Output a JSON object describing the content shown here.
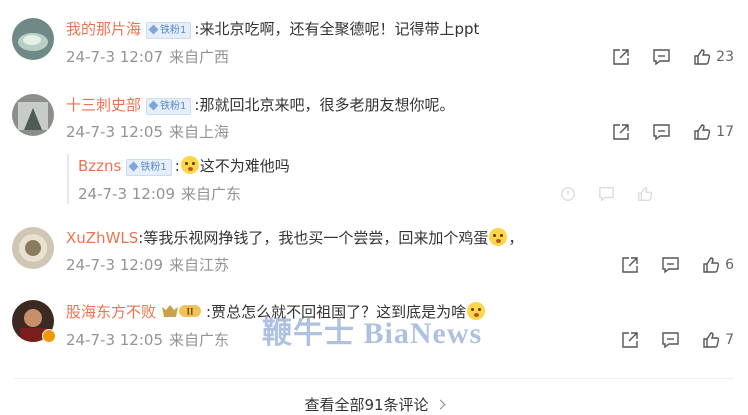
{
  "comments": [
    {
      "username": "我的那片海",
      "badge": "铁粉1",
      "text": ":来北京吃啊，还有全聚德呢！记得带上ppt",
      "date": "24-7-3 12:07",
      "location": "来自广西",
      "likes": "23"
    },
    {
      "username": "十三刺史部",
      "badge": "铁粉1",
      "text": ":那就回北京来吧，很多老朋友想你呢。",
      "date": "24-7-3 12:05",
      "location": "来自上海",
      "likes": "17"
    },
    {
      "username": "Bzzns",
      "badge": "铁粉1",
      "text_prefix": ":",
      "text": "这不为难他吗",
      "date": "24-7-3 12:09",
      "location": "来自广东"
    },
    {
      "username": "XuZhWLS",
      "text": ":等我乐视网挣钱了，我也买一个尝尝，回来加个鸡蛋",
      "text_suffix": "，",
      "date": "24-7-3 12:09",
      "location": "来自江苏",
      "likes": "6"
    },
    {
      "username": "股海东方不败",
      "vip_level": "II",
      "text": ":贾总怎么就不回祖国了？这到底是为啥",
      "date": "24-7-3 12:05",
      "location": "来自广东",
      "likes": "7"
    }
  ],
  "watermark": "鞭牛士 BiaNews",
  "view_all": "查看全部91条评论",
  "icons": {
    "share": "share-icon",
    "comment": "comment-icon",
    "like": "thumbs-up-icon"
  },
  "colors": {
    "username": "#eb7350",
    "meta": "#939393"
  }
}
